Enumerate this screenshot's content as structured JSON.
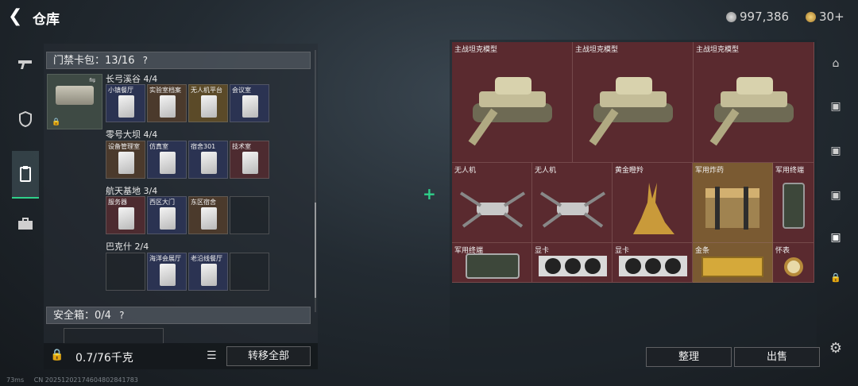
{
  "header": {
    "title": "仓库",
    "currency": "997,386",
    "coins": "30+"
  },
  "left": {
    "keycard_header": "门禁卡包：13/16",
    "help": "?",
    "groups": [
      {
        "label": "长弓溪谷 4/4",
        "cards": [
          {
            "name": "小镇餐厅",
            "color": "blue"
          },
          {
            "name": "实验室档案",
            "color": "brown"
          },
          {
            "name": "无人机平台",
            "color": "gold"
          },
          {
            "name": "会议室",
            "color": "blue"
          }
        ]
      },
      {
        "label": "零号大坝 4/4",
        "cards": [
          {
            "name": "设备管理室",
            "color": "brown"
          },
          {
            "name": "仿真室",
            "color": "blue"
          },
          {
            "name": "宿舍301",
            "color": "blue"
          },
          {
            "name": "技术室",
            "color": "red"
          }
        ]
      },
      {
        "label": "航天基地 3/4",
        "cards": [
          {
            "name": "服务器",
            "color": "red"
          },
          {
            "name": "西区大门",
            "color": "blue"
          },
          {
            "name": "东区宿舍",
            "color": "brown"
          },
          {
            "name": "",
            "color": "empty"
          }
        ]
      },
      {
        "label": "巴克什 2/4",
        "cards": [
          {
            "name": "",
            "color": "empty"
          },
          {
            "name": "海洋会展厅",
            "color": "blue"
          },
          {
            "name": "老沿线餐厅",
            "color": "blue"
          },
          {
            "name": "",
            "color": "empty"
          }
        ]
      }
    ],
    "safe_header": "安全箱：0/4",
    "weight": "0.7/76千克",
    "transfer_all": "转移全部"
  },
  "right": {
    "items": [
      {
        "name": "主战坦克模型",
        "icon": "tank-model-icon"
      },
      {
        "name": "主战坦克模型",
        "icon": "tank-model-icon"
      },
      {
        "name": "主战坦克模型",
        "icon": "tank-model-icon"
      },
      {
        "name": "无人机",
        "icon": "drone-icon"
      },
      {
        "name": "无人机",
        "icon": "drone-icon"
      },
      {
        "name": "黄金瞪羚",
        "icon": "gold-gazelle-icon"
      },
      {
        "name": "军用炸药",
        "icon": "explosives-crate-icon"
      },
      {
        "name": "军用终端",
        "icon": "terminal-icon"
      },
      {
        "name": "军用终端",
        "icon": "tablet-icon"
      },
      {
        "name": "显卡",
        "icon": "gpu-icon"
      },
      {
        "name": "显卡",
        "icon": "gpu-icon"
      },
      {
        "name": "金条",
        "icon": "gold-bar-icon"
      },
      {
        "name": "怀表",
        "icon": "pocket-watch-icon"
      }
    ],
    "sort_label": "整理",
    "sell_label": "出售"
  },
  "status": {
    "ping": "73ms",
    "id": "CN 20251202174604802841783"
  },
  "colors": {
    "accent_green": "#2fd08a",
    "grid_red": "#5a2a2f",
    "gold_tile": "#7a5a32"
  }
}
